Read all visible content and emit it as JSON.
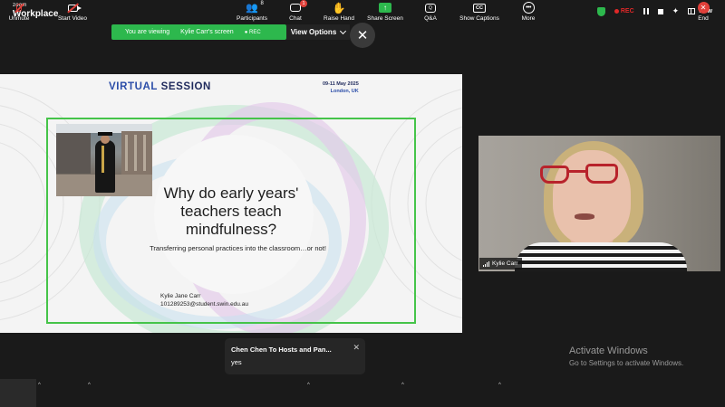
{
  "app": {
    "brand_small": "zoom",
    "brand_big": "Workplace",
    "rec_label": "REC",
    "view_label": "View"
  },
  "share_banner": {
    "viewing_prefix": "You are viewing",
    "presenter": "Kylie Carr's screen",
    "rec_label": "REC",
    "view_options_label": "View Options",
    "close_glyph": "✕"
  },
  "slide": {
    "title_virtual": "VIRTUAL",
    "title_session": "SESSION",
    "date": "09-11 May 2025",
    "location": "London, UK",
    "heading": "Why do early years' teachers teach mindfulness?",
    "subtitle": "Transferring personal practices into the classroom…or not!",
    "author_name": "Kylie Jane Carr",
    "author_email": "101289253@student.swin.edu.au"
  },
  "video": {
    "participant_name": "Kylie Carr"
  },
  "chat_toast": {
    "from": "Chen Chen To Hosts and Pan...",
    "message": "yes",
    "close_glyph": "✕"
  },
  "watermark": {
    "line1": "Activate Windows",
    "line2": "Go to Settings to activate Windows."
  },
  "toolbar": {
    "unmute": "Unmute",
    "start_video": "Start Video",
    "participants": "Participants",
    "participants_count": "8",
    "chat": "Chat",
    "chat_badge": "1",
    "raise_hand": "Raise Hand",
    "share_screen": "Share Screen",
    "qa": "Q&A",
    "show_captions": "Show Captions",
    "more": "More",
    "end": "End"
  },
  "colors": {
    "accent_green": "#2db84d",
    "slide_frame_green": "#45c449",
    "recording_red": "#e02828",
    "end_red": "#e0403a",
    "navy": "#1f2a5c"
  },
  "icons": [
    "shield-icon",
    "record-icon",
    "pause-icon",
    "stop-icon",
    "sparkle-icon",
    "view-icon",
    "mic-muted-icon",
    "video-off-icon",
    "participants-icon",
    "chat-icon",
    "raise-hand-icon",
    "share-screen-icon",
    "qa-icon",
    "captions-icon",
    "more-icon",
    "end-icon"
  ]
}
